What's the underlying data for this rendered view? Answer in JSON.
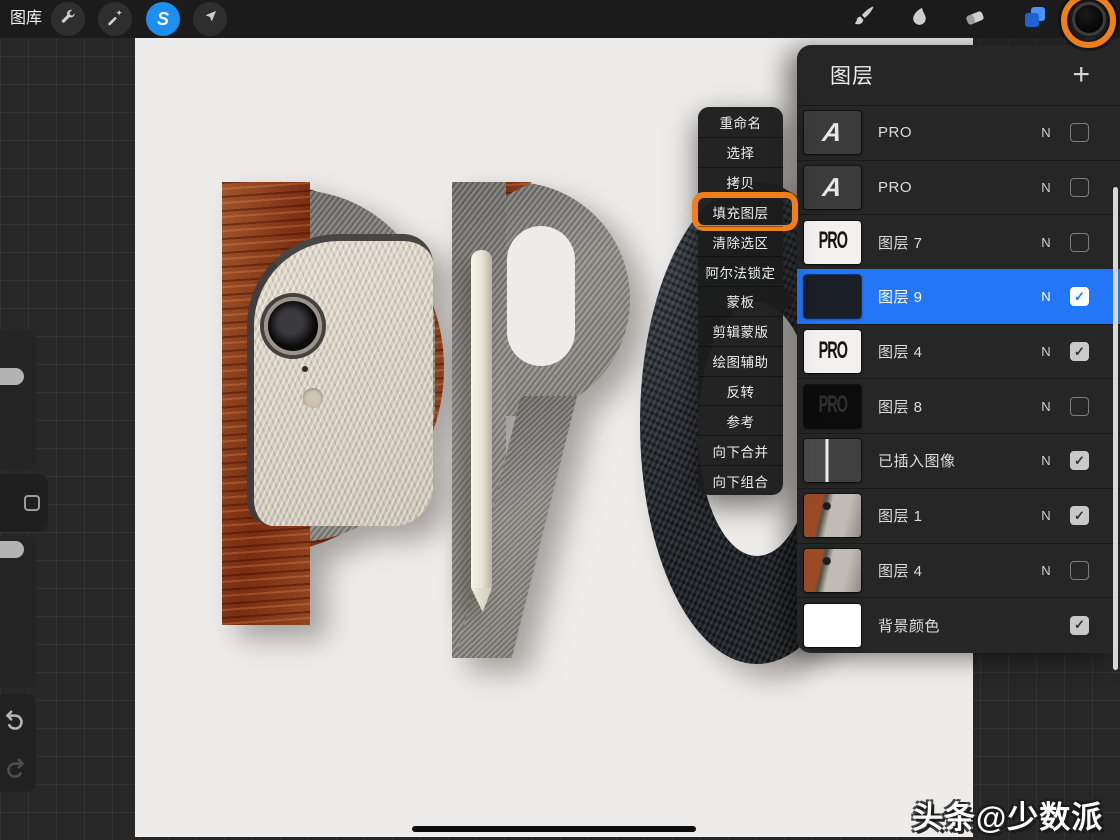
{
  "toolbar": {
    "gallery_label": "图库",
    "left_tools": [
      "wrench",
      "magic-wand",
      "selection",
      "transform-arrow"
    ],
    "active_left_tool": "selection",
    "selection_glyph": "S",
    "right_tools": [
      "brush",
      "smudge",
      "eraser",
      "layers",
      "color"
    ],
    "active_right_tool": "layers",
    "current_color": "#0a0a0a"
  },
  "sidebar": {
    "tools": [
      "brush-size-slider",
      "modify-button",
      "opacity-slider",
      "undo",
      "redo"
    ]
  },
  "layers_panel": {
    "title": "图层",
    "add_label": "+",
    "layers": [
      {
        "name": "PRO",
        "blend": "N",
        "checked": false,
        "selected": false,
        "thumb": "text-a"
      },
      {
        "name": "PRO",
        "blend": "N",
        "checked": false,
        "selected": false,
        "thumb": "text-a"
      },
      {
        "name": "图层 7",
        "blend": "N",
        "checked": false,
        "selected": false,
        "thumb": "pro-light"
      },
      {
        "name": "图层 9",
        "blend": "N",
        "checked": true,
        "selected": true,
        "thumb": "dark"
      },
      {
        "name": "图层 4",
        "blend": "N",
        "checked": true,
        "selected": false,
        "thumb": "pro-light"
      },
      {
        "name": "图层 8",
        "blend": "N",
        "checked": false,
        "selected": false,
        "thumb": "pro-dark"
      },
      {
        "name": "已插入图像",
        "blend": "N",
        "checked": true,
        "selected": false,
        "thumb": "pencil"
      },
      {
        "name": "图层 1",
        "blend": "N",
        "checked": true,
        "selected": false,
        "thumb": "photo"
      },
      {
        "name": "图层 4",
        "blend": "N",
        "checked": false,
        "selected": false,
        "thumb": "photo"
      },
      {
        "name": "背景颜色",
        "blend": "",
        "checked": true,
        "selected": false,
        "thumb": "white"
      }
    ]
  },
  "context_menu": {
    "items": [
      "重命名",
      "选择",
      "拷贝",
      "填充图层",
      "清除选区",
      "阿尔法锁定",
      "蒙板",
      "剪辑蒙版",
      "绘图辅助",
      "反转",
      "参考",
      "向下合并",
      "向下组合"
    ],
    "highlighted_item": "填充图层"
  },
  "canvas": {
    "word": "PRO",
    "letters": [
      "P",
      "R",
      "O"
    ]
  },
  "thumb_glyphs": {
    "text_a": "A",
    "pro": "PRO"
  },
  "glyphs": {
    "check": "✓"
  },
  "watermark": "头条@少数派",
  "colors": {
    "selection_blue": "#1d8ff0",
    "layers_icon_blue": "#2574f5",
    "selected_row_blue": "#2377f7",
    "annotation_orange": "#ef7f18"
  }
}
